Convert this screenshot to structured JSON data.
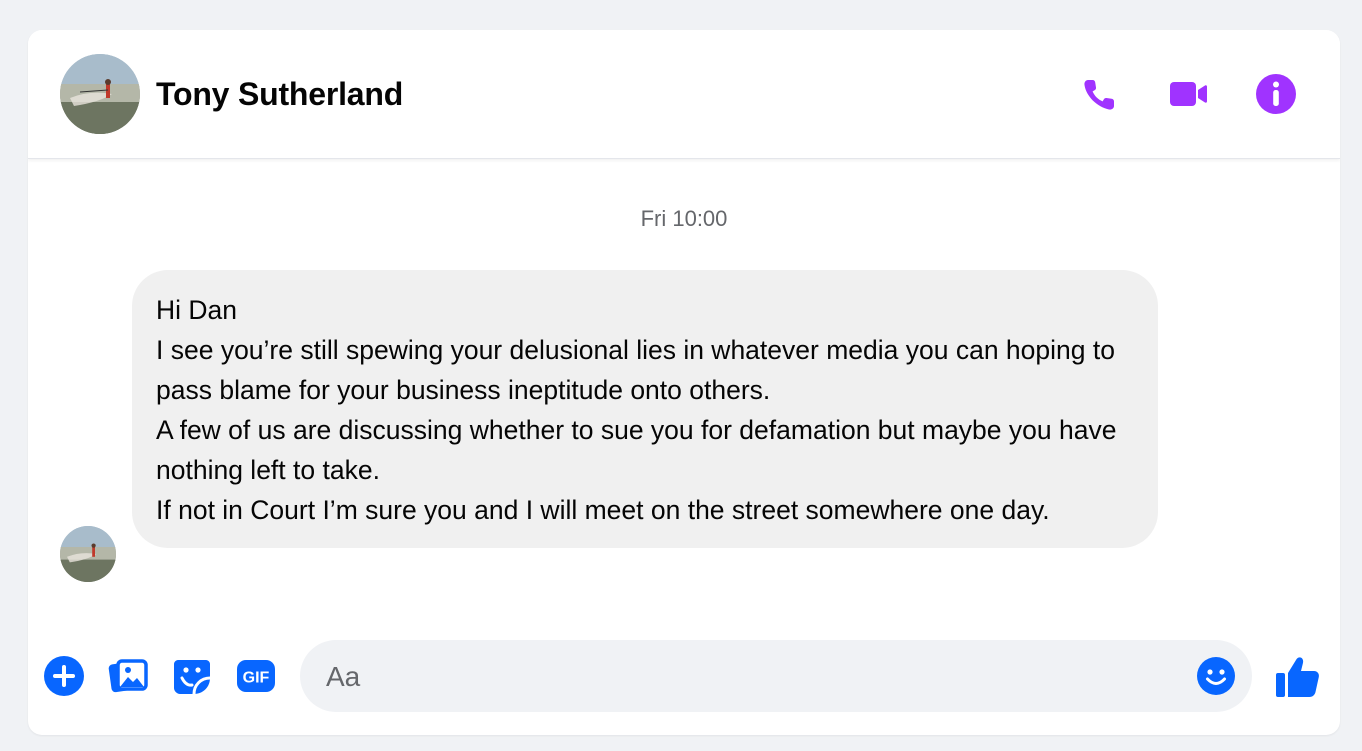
{
  "colors": {
    "accent": "#a033ff",
    "composer": "#0866ff",
    "bubble": "#f0f0f0",
    "timestamp": "#65676b"
  },
  "header": {
    "contact_name": "Tony Sutherland",
    "icons": [
      "phone-icon",
      "video-camera-icon",
      "info-icon"
    ]
  },
  "conversation": {
    "timestamp": "Fri 10:00",
    "messages": [
      {
        "sender": "Tony Sutherland",
        "text": "Hi Dan\nI see you’re still spewing your delusional lies in whatever media you can hoping to pass blame for your business ineptitude onto others.\nA few of us are discussing whether to sue you for defamation but maybe you have nothing left to take.\nIf not in Court I’m sure you and I will meet on the street somewhere one day."
      }
    ]
  },
  "composer": {
    "placeholder": "Aa",
    "value": "",
    "icons": [
      "plus-icon",
      "photo-icon",
      "sticker-icon",
      "gif-icon",
      "emoji-icon",
      "like-icon"
    ]
  }
}
